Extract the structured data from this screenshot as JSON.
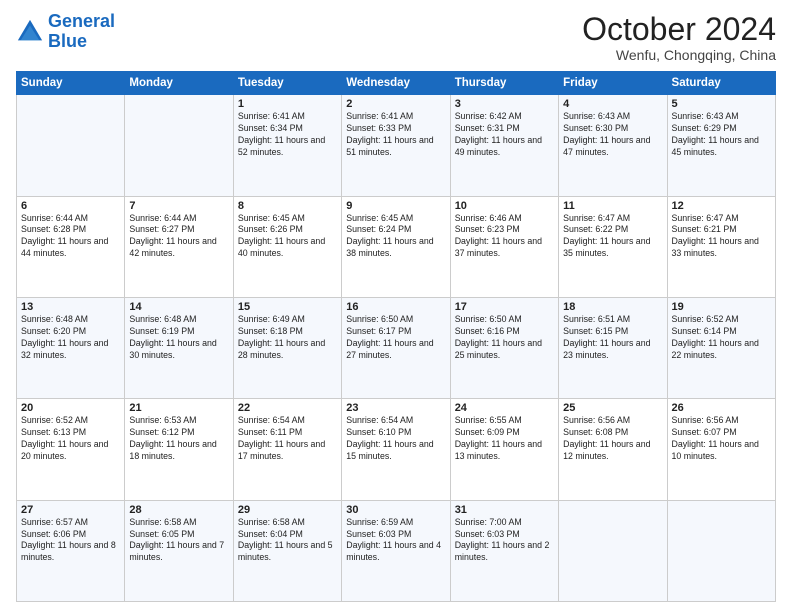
{
  "header": {
    "logo_line1": "General",
    "logo_line2": "Blue",
    "month": "October 2024",
    "location": "Wenfu, Chongqing, China"
  },
  "days_of_week": [
    "Sunday",
    "Monday",
    "Tuesday",
    "Wednesday",
    "Thursday",
    "Friday",
    "Saturday"
  ],
  "weeks": [
    [
      {
        "day": "",
        "info": ""
      },
      {
        "day": "",
        "info": ""
      },
      {
        "day": "1",
        "info": "Sunrise: 6:41 AM\nSunset: 6:34 PM\nDaylight: 11 hours and 52 minutes."
      },
      {
        "day": "2",
        "info": "Sunrise: 6:41 AM\nSunset: 6:33 PM\nDaylight: 11 hours and 51 minutes."
      },
      {
        "day": "3",
        "info": "Sunrise: 6:42 AM\nSunset: 6:31 PM\nDaylight: 11 hours and 49 minutes."
      },
      {
        "day": "4",
        "info": "Sunrise: 6:43 AM\nSunset: 6:30 PM\nDaylight: 11 hours and 47 minutes."
      },
      {
        "day": "5",
        "info": "Sunrise: 6:43 AM\nSunset: 6:29 PM\nDaylight: 11 hours and 45 minutes."
      }
    ],
    [
      {
        "day": "6",
        "info": "Sunrise: 6:44 AM\nSunset: 6:28 PM\nDaylight: 11 hours and 44 minutes."
      },
      {
        "day": "7",
        "info": "Sunrise: 6:44 AM\nSunset: 6:27 PM\nDaylight: 11 hours and 42 minutes."
      },
      {
        "day": "8",
        "info": "Sunrise: 6:45 AM\nSunset: 6:26 PM\nDaylight: 11 hours and 40 minutes."
      },
      {
        "day": "9",
        "info": "Sunrise: 6:45 AM\nSunset: 6:24 PM\nDaylight: 11 hours and 38 minutes."
      },
      {
        "day": "10",
        "info": "Sunrise: 6:46 AM\nSunset: 6:23 PM\nDaylight: 11 hours and 37 minutes."
      },
      {
        "day": "11",
        "info": "Sunrise: 6:47 AM\nSunset: 6:22 PM\nDaylight: 11 hours and 35 minutes."
      },
      {
        "day": "12",
        "info": "Sunrise: 6:47 AM\nSunset: 6:21 PM\nDaylight: 11 hours and 33 minutes."
      }
    ],
    [
      {
        "day": "13",
        "info": "Sunrise: 6:48 AM\nSunset: 6:20 PM\nDaylight: 11 hours and 32 minutes."
      },
      {
        "day": "14",
        "info": "Sunrise: 6:48 AM\nSunset: 6:19 PM\nDaylight: 11 hours and 30 minutes."
      },
      {
        "day": "15",
        "info": "Sunrise: 6:49 AM\nSunset: 6:18 PM\nDaylight: 11 hours and 28 minutes."
      },
      {
        "day": "16",
        "info": "Sunrise: 6:50 AM\nSunset: 6:17 PM\nDaylight: 11 hours and 27 minutes."
      },
      {
        "day": "17",
        "info": "Sunrise: 6:50 AM\nSunset: 6:16 PM\nDaylight: 11 hours and 25 minutes."
      },
      {
        "day": "18",
        "info": "Sunrise: 6:51 AM\nSunset: 6:15 PM\nDaylight: 11 hours and 23 minutes."
      },
      {
        "day": "19",
        "info": "Sunrise: 6:52 AM\nSunset: 6:14 PM\nDaylight: 11 hours and 22 minutes."
      }
    ],
    [
      {
        "day": "20",
        "info": "Sunrise: 6:52 AM\nSunset: 6:13 PM\nDaylight: 11 hours and 20 minutes."
      },
      {
        "day": "21",
        "info": "Sunrise: 6:53 AM\nSunset: 6:12 PM\nDaylight: 11 hours and 18 minutes."
      },
      {
        "day": "22",
        "info": "Sunrise: 6:54 AM\nSunset: 6:11 PM\nDaylight: 11 hours and 17 minutes."
      },
      {
        "day": "23",
        "info": "Sunrise: 6:54 AM\nSunset: 6:10 PM\nDaylight: 11 hours and 15 minutes."
      },
      {
        "day": "24",
        "info": "Sunrise: 6:55 AM\nSunset: 6:09 PM\nDaylight: 11 hours and 13 minutes."
      },
      {
        "day": "25",
        "info": "Sunrise: 6:56 AM\nSunset: 6:08 PM\nDaylight: 11 hours and 12 minutes."
      },
      {
        "day": "26",
        "info": "Sunrise: 6:56 AM\nSunset: 6:07 PM\nDaylight: 11 hours and 10 minutes."
      }
    ],
    [
      {
        "day": "27",
        "info": "Sunrise: 6:57 AM\nSunset: 6:06 PM\nDaylight: 11 hours and 8 minutes."
      },
      {
        "day": "28",
        "info": "Sunrise: 6:58 AM\nSunset: 6:05 PM\nDaylight: 11 hours and 7 minutes."
      },
      {
        "day": "29",
        "info": "Sunrise: 6:58 AM\nSunset: 6:04 PM\nDaylight: 11 hours and 5 minutes."
      },
      {
        "day": "30",
        "info": "Sunrise: 6:59 AM\nSunset: 6:03 PM\nDaylight: 11 hours and 4 minutes."
      },
      {
        "day": "31",
        "info": "Sunrise: 7:00 AM\nSunset: 6:03 PM\nDaylight: 11 hours and 2 minutes."
      },
      {
        "day": "",
        "info": ""
      },
      {
        "day": "",
        "info": ""
      }
    ]
  ]
}
